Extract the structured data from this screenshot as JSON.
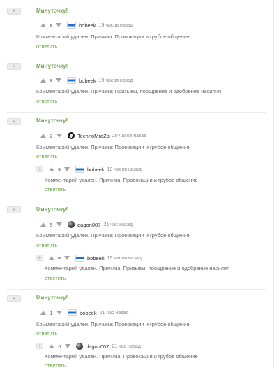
{
  "common": {
    "collapse_label": "+",
    "reply_label": "ответить",
    "mark": "Минуточку!"
  },
  "comments": [
    {
      "score": "",
      "username": "bobeek",
      "time": "19 часов назад",
      "text": "Комментарий удален. Причина: Провокации и грубое общение"
    },
    {
      "score": "",
      "username": "bobeek",
      "time": "19 часов назад",
      "text": "Комментарий удален. Причина: Призывы, поощрение и одобрение насилия"
    },
    {
      "score": "2",
      "username": "TechnoMraZb",
      "time": "20 часов назад",
      "text": "Комментарий удален. Причина: Провокации и грубое общение"
    },
    {
      "score": "",
      "username": "bobeek",
      "time": "19 часов назад",
      "text": "Комментарий удален. Причина: Провокации и грубое общение"
    },
    {
      "score": "5",
      "username": "dagon007",
      "time": "21 час назад",
      "text": "Комментарий удален. Причина: Провокации и грубое общение"
    },
    {
      "score": "",
      "username": "bobeek",
      "time": "19 часов назад",
      "text": "Комментарий удален. Причина: Призывы, поощрение и одобрение насилия"
    },
    {
      "score": "1",
      "username": "bobeek",
      "time": "21 час назад",
      "text": "Комментарий удален. Причина: Провокации и грубое общение"
    },
    {
      "score": "5",
      "username": "dagon007",
      "time": "21 час назад",
      "text": "Комментарий удален. Причина: Провокации и грубое общение"
    }
  ]
}
